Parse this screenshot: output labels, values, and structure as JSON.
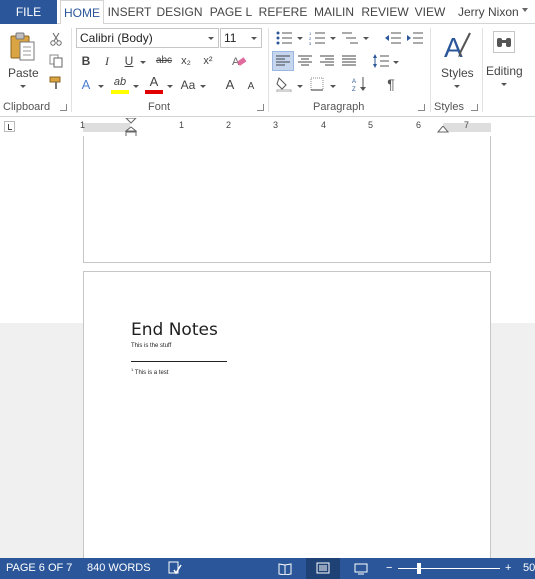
{
  "tabs": {
    "file": "FILE",
    "home": "HOME",
    "insert": "INSERT",
    "design": "DESIGN",
    "page_layout": "PAGE L",
    "references": "REFERE",
    "mailings": "MAILIN",
    "review": "REVIEW",
    "view": "VIEW"
  },
  "user": {
    "name": "Jerry Nixon"
  },
  "clipboard": {
    "paste_label": "Paste",
    "group_label": "Clipboard"
  },
  "font": {
    "name": "Calibri (Body)",
    "size": "11",
    "bold": "B",
    "italic": "I",
    "underline": "U",
    "strikethrough": "abc",
    "subscript": "x₂",
    "superscript": "x²",
    "text_effects": "A",
    "highlight": "ab",
    "font_color": "A",
    "change_case": "Aa",
    "grow": "A",
    "shrink": "A",
    "group_label": "Font"
  },
  "paragraph": {
    "pilcrow": "¶",
    "group_label": "Paragraph"
  },
  "styles": {
    "label": "Styles",
    "group_label": "Styles"
  },
  "editing": {
    "label": "Editing"
  },
  "ruler": {
    "numbers": [
      "1",
      "1",
      "2",
      "3",
      "4",
      "5",
      "6",
      "7"
    ]
  },
  "document": {
    "heading": "End Notes",
    "body": "This is the stuff",
    "endnote_ref": "1",
    "endnote": "This is a test"
  },
  "status": {
    "page": "PAGE 6 OF 7",
    "words": "840 WORDS",
    "zoom_out": "−",
    "zoom_in": "+",
    "zoom": "50",
    "zoom_level": 0.19
  },
  "colors": {
    "brand": "#2b579a",
    "highlight": "#ffff00",
    "font_color": "#e00000"
  }
}
